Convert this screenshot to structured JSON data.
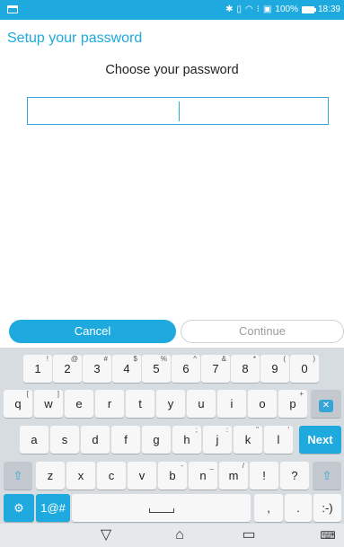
{
  "status_bar": {
    "time": "18:39",
    "battery": "100%",
    "icons": [
      "notification-icon",
      "bluetooth-icon",
      "vibrate-icon",
      "wifi-icon",
      "data-icon",
      "battery-icon"
    ]
  },
  "header": {
    "title": "Setup your password"
  },
  "main": {
    "subtitle": "Choose your password",
    "password_input": {
      "value": "",
      "placeholder": ""
    }
  },
  "actions": {
    "cancel_label": "Cancel",
    "continue_label": "Continue"
  },
  "keyboard": {
    "row1": [
      {
        "k": "1",
        "h": "!"
      },
      {
        "k": "2",
        "h": "@"
      },
      {
        "k": "3",
        "h": "#"
      },
      {
        "k": "4",
        "h": "$"
      },
      {
        "k": "5",
        "h": "%"
      },
      {
        "k": "6",
        "h": "^"
      },
      {
        "k": "7",
        "h": "&"
      },
      {
        "k": "8",
        "h": "*"
      },
      {
        "k": "9",
        "h": "("
      },
      {
        "k": "0",
        "h": ")"
      }
    ],
    "row2": [
      {
        "k": "q",
        "h": "["
      },
      {
        "k": "w",
        "h": "]"
      },
      {
        "k": "e",
        "h": ""
      },
      {
        "k": "r",
        "h": ""
      },
      {
        "k": "t",
        "h": ""
      },
      {
        "k": "y",
        "h": ""
      },
      {
        "k": "u",
        "h": ""
      },
      {
        "k": "i",
        "h": ""
      },
      {
        "k": "o",
        "h": ""
      },
      {
        "k": "p",
        "h": "+"
      }
    ],
    "row3": [
      {
        "k": "a",
        "h": ""
      },
      {
        "k": "s",
        "h": ""
      },
      {
        "k": "d",
        "h": ""
      },
      {
        "k": "f",
        "h": ""
      },
      {
        "k": "g",
        "h": ""
      },
      {
        "k": "h",
        "h": ";"
      },
      {
        "k": "j",
        "h": ":"
      },
      {
        "k": "k",
        "h": "\""
      },
      {
        "k": "l",
        "h": "'"
      }
    ],
    "row4": [
      {
        "k": "z",
        "h": ""
      },
      {
        "k": "x",
        "h": ""
      },
      {
        "k": "c",
        "h": ""
      },
      {
        "k": "v",
        "h": ""
      },
      {
        "k": "b",
        "h": "-"
      },
      {
        "k": "n",
        "h": "_"
      },
      {
        "k": "m",
        "h": "/"
      },
      {
        "k": "!",
        "h": ""
      },
      {
        "k": "?",
        "h": ""
      }
    ],
    "next_label": "Next",
    "symbols_label": "1@#",
    "comma_label": ",",
    "period_label": ".",
    "emoji_label": ":-)"
  },
  "nav_bar": {
    "icons": [
      "back-icon",
      "home-icon",
      "recents-icon",
      "keyboard-icon"
    ]
  },
  "colors": {
    "accent": "#1eaadf",
    "keyboard_bg": "#d7dce0",
    "key_bg": "#f7f7f7"
  }
}
